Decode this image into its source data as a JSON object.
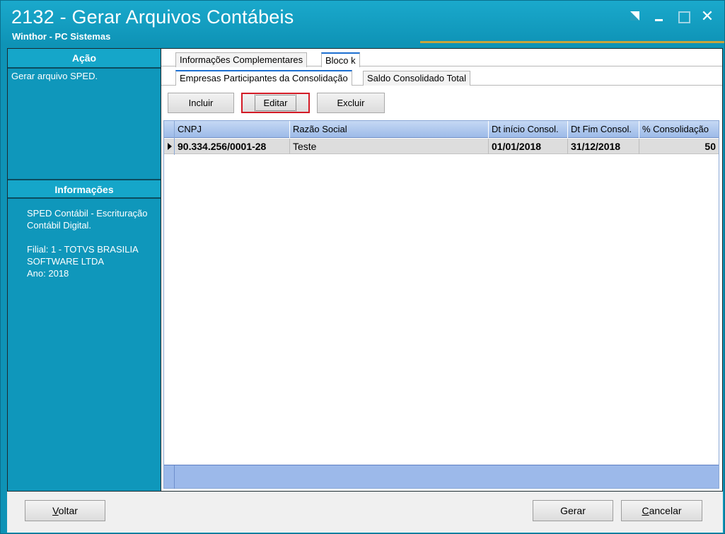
{
  "window": {
    "title": "2132 - Gerar Arquivos Contábeis",
    "subtitle": "Winthor - PC Sistemas"
  },
  "sidebar": {
    "action_header": "Ação",
    "action_text": "Gerar arquivo SPED.",
    "info_header": "Informações",
    "info_line1": "SPED Contábil - Escrituração Contábil Digital.",
    "info_line2": "Filial: 1 - TOTVS BRASILIA SOFTWARE LTDA",
    "info_line3": "Ano: 2018"
  },
  "tabs": {
    "primary": [
      "Informações Complementares",
      "Bloco k"
    ],
    "primary_active": "Bloco k",
    "secondary": [
      "Empresas Participantes da Consolidação",
      "Saldo Consolidado Total"
    ],
    "secondary_active": "Empresas Participantes da Consolidação"
  },
  "toolbar": {
    "incluir": "Incluir",
    "editar": "Editar",
    "excluir": "Excluir"
  },
  "grid": {
    "columns": [
      "CNPJ",
      "Razão Social",
      "Dt início Consol.",
      "Dt Fim Consol.",
      "% Consolidação"
    ],
    "rows": [
      [
        "90.334.256/0001-28",
        "Teste",
        "01/01/2018",
        "31/12/2018",
        "50"
      ]
    ]
  },
  "footer": {
    "voltar_prefix": "V",
    "voltar_rest": "oltar",
    "gerar": "Gerar",
    "cancelar_prefix": "C",
    "cancelar_rest": "ancelar"
  },
  "colors": {
    "titlebar": "#0e93b6",
    "accent_line": "#c9a43a",
    "grid_header": "#9dbbe8",
    "focus_border": "#d31b26"
  }
}
